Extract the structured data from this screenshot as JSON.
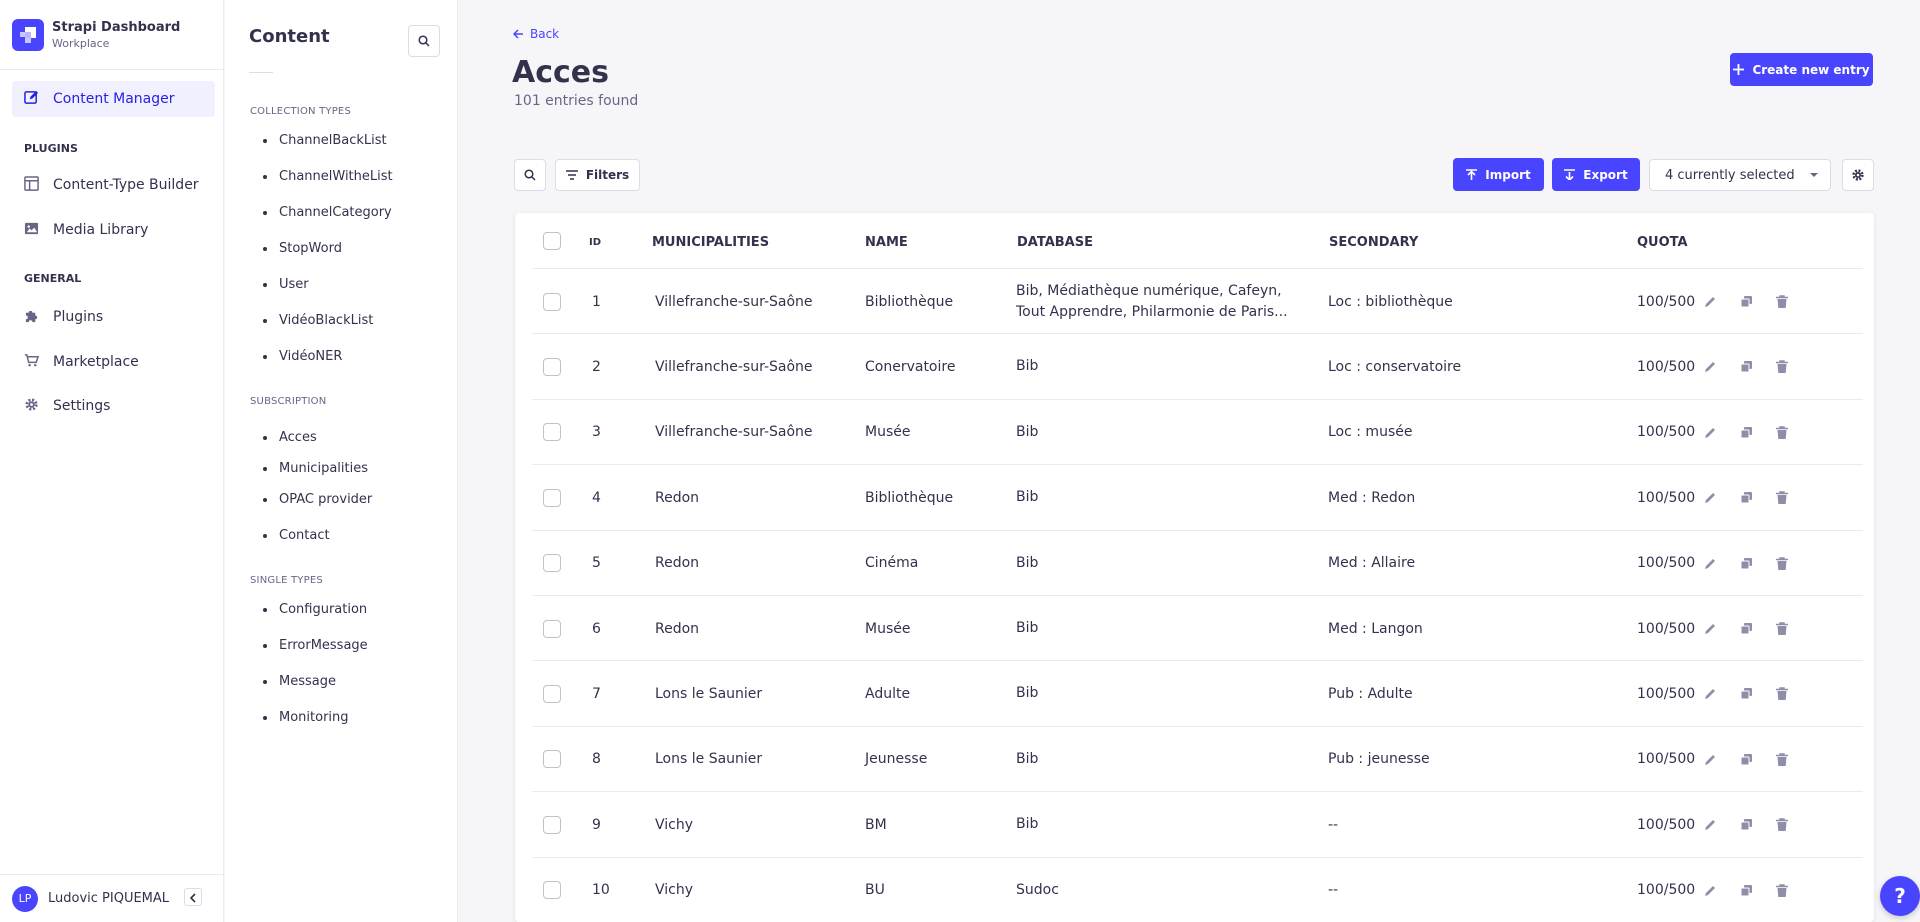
{
  "brand": {
    "title": "Strapi Dashboard",
    "subtitle": "Workplace"
  },
  "mainnav": {
    "active_label": "Content Manager",
    "plugins_section": "PLUGINS",
    "general_section": "GENERAL",
    "items": {
      "content_type_builder": "Content-Type Builder",
      "media_library": "Media Library",
      "plugins": "Plugins",
      "marketplace": "Marketplace",
      "settings": "Settings"
    },
    "user": {
      "initials": "LP",
      "name": "Ludovic PIQUEMAL"
    }
  },
  "subnav": {
    "title": "Content",
    "collection_section": "COLLECTION TYPES",
    "collection_items": [
      "ChannelBackList",
      "ChannelWitheList",
      "ChannelCategory",
      "StopWord",
      "User",
      "VidéoBlackList",
      "VidéoNER"
    ],
    "subscription_section": "SUBSCRIPTION",
    "subscription_items": [
      "Acces",
      "Municipalities",
      "OPAC provider",
      "Contact"
    ],
    "single_section": "SINGLE TYPES",
    "single_items": [
      "Configuration",
      "ErrorMessage",
      "Message",
      "Monitoring"
    ]
  },
  "header": {
    "back_label": "Back",
    "title": "Acces",
    "subtitle": "101 entries found",
    "create_label": "Create new entry"
  },
  "toolbar": {
    "filters_label": "Filters",
    "import_label": "Import",
    "export_label": "Export",
    "columns_select_value": "4 currently selected"
  },
  "table": {
    "headers": [
      "ID",
      "MUNICIPALITIES",
      "NAME",
      "DATABASE",
      "SECONDARY",
      "QUOTA"
    ],
    "rows": [
      {
        "id": "1",
        "municipality": "Villefranche-sur-Saône",
        "name": "Bibliothèque",
        "database_line1": "Bib, Médiathèque numérique, Cafeyn,",
        "database_line2": "Tout Apprendre, Philarmonie de Paris...",
        "secondary": "Loc : bibliothèque",
        "quota": "100/500"
      },
      {
        "id": "2",
        "municipality": "Villefranche-sur-Saône",
        "name": "Conervatoire",
        "database_line1": "Bib",
        "database_line2": "",
        "secondary": "Loc : conservatoire",
        "quota": "100/500"
      },
      {
        "id": "3",
        "municipality": "Villefranche-sur-Saône",
        "name": "Musée",
        "database_line1": "Bib",
        "database_line2": "",
        "secondary": "Loc : musée",
        "quota": "100/500"
      },
      {
        "id": "4",
        "municipality": "Redon",
        "name": "Bibliothèque",
        "database_line1": "Bib",
        "database_line2": "",
        "secondary": "Med : Redon",
        "quota": "100/500"
      },
      {
        "id": "5",
        "municipality": "Redon",
        "name": "Cinéma",
        "database_line1": "Bib",
        "database_line2": "",
        "secondary": "Med : Allaire",
        "quota": "100/500"
      },
      {
        "id": "6",
        "municipality": "Redon",
        "name": "Musée",
        "database_line1": "Bib",
        "database_line2": "",
        "secondary": "Med : Langon",
        "quota": "100/500"
      },
      {
        "id": "7",
        "municipality": "Lons le Saunier",
        "name": "Adulte",
        "database_line1": "Bib",
        "database_line2": "",
        "secondary": "Pub : Adulte",
        "quota": "100/500"
      },
      {
        "id": "8",
        "municipality": "Lons le Saunier",
        "name": "Jeunesse",
        "database_line1": "Bib",
        "database_line2": "",
        "secondary": "Pub : jeunesse",
        "quota": "100/500"
      },
      {
        "id": "9",
        "municipality": "Vichy",
        "name": "BM",
        "database_line1": "Bib",
        "database_line2": "",
        "secondary": "--",
        "quota": "100/500"
      },
      {
        "id": "10",
        "municipality": "Vichy",
        "name": "BU",
        "database_line1": "Sudoc",
        "database_line2": "",
        "secondary": "--",
        "quota": "100/500"
      }
    ]
  },
  "help": {
    "label": "?"
  },
  "colors": {
    "primary": "#4945ff",
    "active_bg": "#f0f0ff",
    "text": "#32324d",
    "muted": "#666687"
  }
}
